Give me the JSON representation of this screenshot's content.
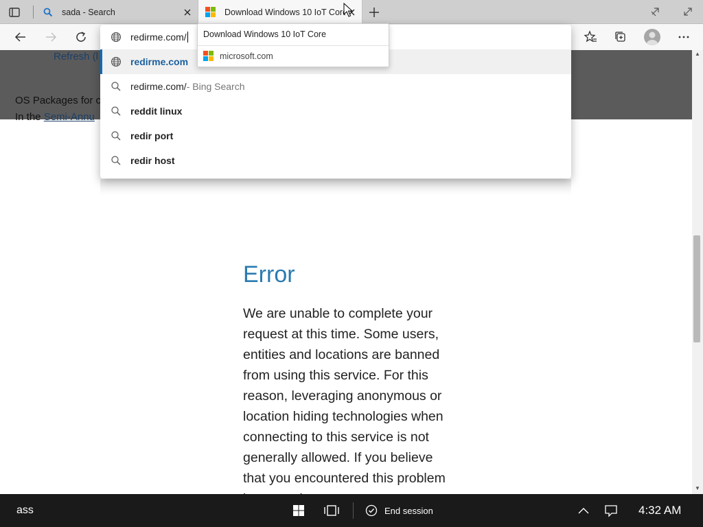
{
  "browser": {
    "tabs": [
      {
        "title": "sada - Search",
        "icon": "search-icon",
        "active": false
      },
      {
        "title": "Download Windows 10 IoT Core",
        "icon": "microsoft-icon",
        "active": true
      }
    ],
    "hover_card": {
      "title": "Download Windows 10 IoT Core",
      "domain": "microsoft.com"
    },
    "address_bar": {
      "typed_value": "redirme.com/"
    },
    "suggestions": [
      {
        "text": "redirme.com",
        "suffix": "",
        "icon": "globe-icon",
        "selected": true,
        "style": "bold-link"
      },
      {
        "text": "redirme.com/",
        "suffix": " - Bing Search",
        "icon": "search-icon",
        "selected": false,
        "style": "normal"
      },
      {
        "text": "reddit linux",
        "suffix": "",
        "icon": "search-icon",
        "selected": false,
        "style": "bold"
      },
      {
        "text": "redir port",
        "suffix": "",
        "icon": "search-icon",
        "selected": false,
        "style": "bold"
      },
      {
        "text": "redir host",
        "suffix": "",
        "icon": "search-icon",
        "selected": false,
        "style": "bold"
      }
    ]
  },
  "page": {
    "behind_text": {
      "refresh": "Refresh (l",
      "os_packages": "OS Packages for c",
      "in_the": "In the ",
      "semi_annual": "Semi-Annu"
    },
    "error_title": "Error",
    "error_body": "We are unable to complete your request at this time. Some users, entities and locations are banned from using this service. For this reason, leveraging anonymous or location hiding technologies when connecting to this service is not generally allowed. If you believe that you encountered this problem in error, please contact"
  },
  "taskbar": {
    "label": "ass",
    "end_session": "End session",
    "clock": "4:32 AM"
  },
  "colors": {
    "accent": "#0f6cbd",
    "error_title": "#2a7ab0",
    "taskbar": "#1a1a1a"
  }
}
